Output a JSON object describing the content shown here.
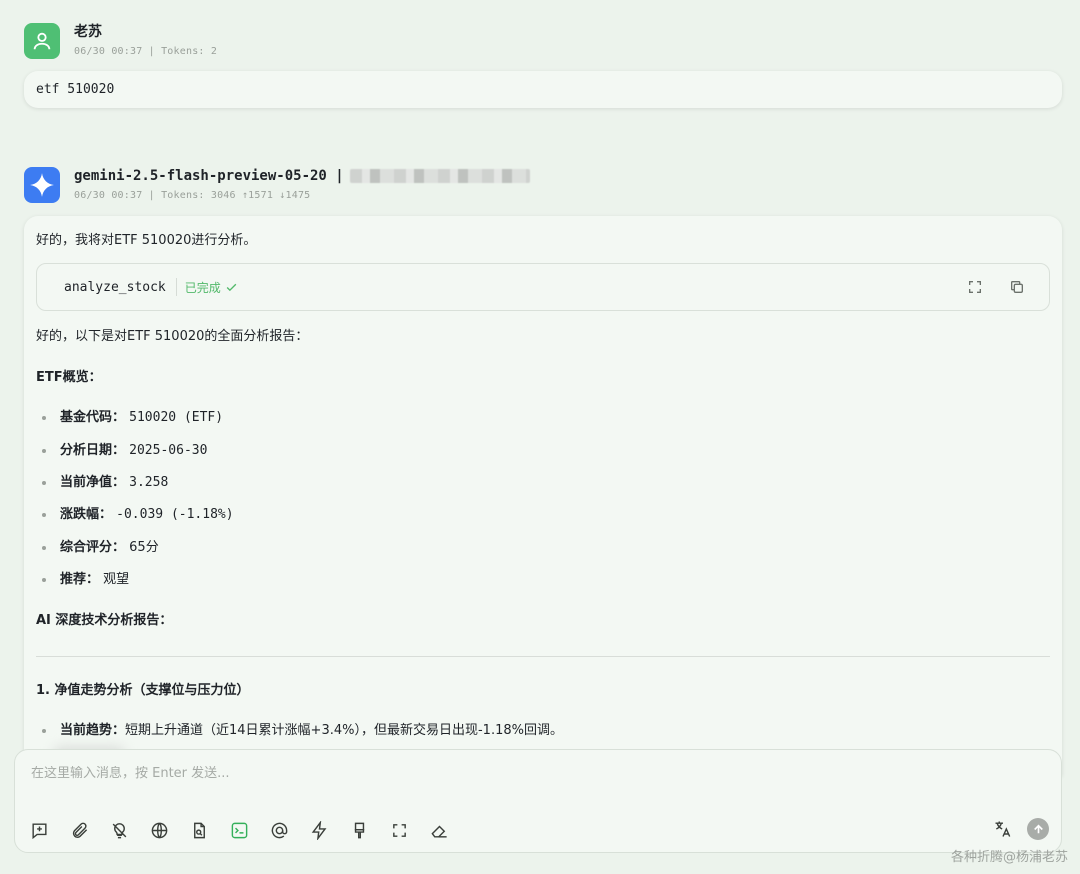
{
  "user_message": {
    "name": "老苏",
    "stats": "06/30 00:37 | Tokens: 2",
    "text": "etf 510020"
  },
  "bot_message": {
    "model": "gemini-2.5-flash-preview-05-20 |",
    "stats": "06/30 00:37 | Tokens: 3046 ↑1571 ↓1475",
    "intro": "好的，我将对ETF 510020进行分析。",
    "tool": {
      "name": "analyze_stock",
      "status": "已完成"
    },
    "report_intro": "好的，以下是对ETF 510020的全面分析报告：",
    "overview_title": "ETF概览：",
    "overview_items": [
      {
        "label": "基金代码：",
        "value": "510020 (ETF)"
      },
      {
        "label": "分析日期：",
        "value": "2025-06-30"
      },
      {
        "label": "当前净值：",
        "value": "3.258"
      },
      {
        "label": "涨跌幅：",
        "value": "-0.039 (-1.18%)"
      },
      {
        "label": "综合评分：",
        "value": "65分"
      },
      {
        "label": "推荐：",
        "value": "观望"
      }
    ],
    "ai_title": "AI 深度技术分析报告：",
    "section1_title": "1. 净值走势分析（支撑位与压力位）",
    "section1_items": [
      {
        "label": "当前趋势：",
        "value": "短期上升通道（近14日累计涨幅+3.4%），但最新交易日出现-1.18%回调。"
      }
    ]
  },
  "input": {
    "placeholder": "在这里输入消息，按 Enter 发送..."
  },
  "watermark": "各种折腾@杨浦老苏",
  "colors": {
    "background": "#ecf3ec",
    "user_avatar": "#4fbf74",
    "bot_avatar": "#3d7cf2",
    "success": "#52b96a"
  }
}
